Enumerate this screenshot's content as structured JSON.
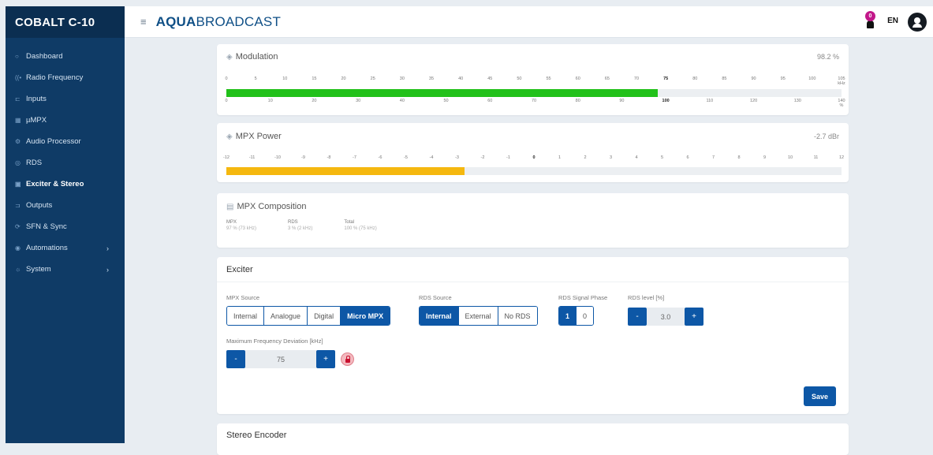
{
  "sidebar": {
    "brand": "COBALT C-10",
    "items": [
      {
        "label": "Dashboard",
        "icon": "circle-icon"
      },
      {
        "label": "Radio Frequency",
        "icon": "signal-icon"
      },
      {
        "label": "Inputs",
        "icon": "input-icon"
      },
      {
        "label": "µMPX",
        "icon": "chip-icon"
      },
      {
        "label": "Audio Processor",
        "icon": "gear-icon"
      },
      {
        "label": "RDS",
        "icon": "broadcast-icon"
      },
      {
        "label": "Exciter & Stereo",
        "icon": "exciter-icon",
        "active": true
      },
      {
        "label": "Outputs",
        "icon": "output-icon"
      },
      {
        "label": "SFN & Sync",
        "icon": "sync-icon"
      },
      {
        "label": "Automations",
        "icon": "automation-icon",
        "chevron": "›"
      },
      {
        "label": "System",
        "icon": "system-icon",
        "chevron": "›"
      }
    ]
  },
  "header": {
    "menu_icon": "≡",
    "logo_bold": "AQUA",
    "logo_rest": "BROADCAST",
    "notification_count": "0",
    "language": "EN"
  },
  "modulation": {
    "title": "Modulation",
    "value": "98.2 %",
    "level_percent": 98.2,
    "fill_color": "#22c11a",
    "top_ticks": [
      "0",
      "5",
      "10",
      "15",
      "20",
      "25",
      "30",
      "35",
      "40",
      "45",
      "50",
      "55",
      "60",
      "65",
      "70",
      "75",
      "80",
      "85",
      "90",
      "95",
      "100",
      "105 kHz"
    ],
    "bottom_ticks": [
      "0",
      "10",
      "20",
      "30",
      "40",
      "50",
      "60",
      "70",
      "80",
      "90",
      "100",
      "110",
      "120",
      "130",
      "140 %"
    ]
  },
  "mpx_power": {
    "title": "MPX Power",
    "value": "-2.7 dBr",
    "level_dbr": -2.7,
    "fill_color": "#f5b80f",
    "ticks": [
      "-12",
      "-11",
      "-10",
      "-9",
      "-8",
      "-7",
      "-6",
      "-5",
      "-4",
      "-3",
      "-2",
      "-1",
      "0",
      "1",
      "2",
      "3",
      "4",
      "5",
      "6",
      "7",
      "8",
      "9",
      "10",
      "11",
      "12"
    ]
  },
  "composition": {
    "title": "MPX Composition",
    "items": [
      {
        "label": "MPX",
        "value": "97 % (73 kHz)"
      },
      {
        "label": "RDS",
        "value": "3 % (2 kHz)"
      },
      {
        "label": "Total",
        "value": "100 % (75 kHz)"
      }
    ]
  },
  "exciter": {
    "title": "Exciter",
    "mpx_source": {
      "label": "MPX Source",
      "options": [
        "Internal",
        "Analogue",
        "Digital",
        "Micro MPX"
      ],
      "selected": "Micro MPX"
    },
    "rds_source": {
      "label": "RDS Source",
      "options": [
        "Internal",
        "External",
        "No RDS"
      ],
      "selected": "Internal"
    },
    "rds_phase": {
      "label": "RDS Signal Phase",
      "options": [
        "1",
        "0"
      ],
      "selected": "1"
    },
    "rds_level": {
      "label": "RDS level [%]",
      "value": "3.0",
      "minus": "-",
      "plus": "+"
    },
    "max_dev": {
      "label": "Maximum Frequency Deviation [kHz]",
      "value": "75",
      "minus": "-",
      "plus": "+"
    },
    "save_label": "Save"
  },
  "stereo": {
    "title": "Stereo Encoder"
  },
  "colors": {
    "sidebar": "#0f3b66",
    "accent": "#0d57a6"
  }
}
